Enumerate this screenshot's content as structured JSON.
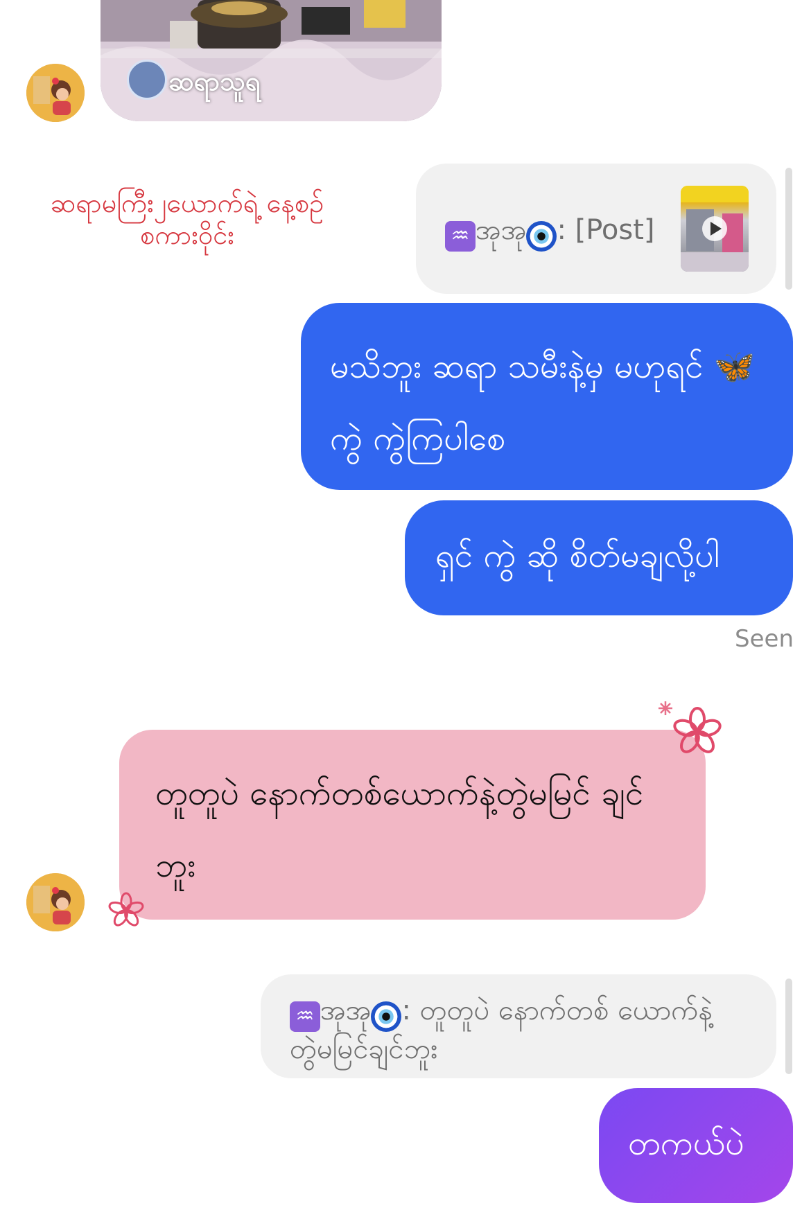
{
  "reel": {
    "author": "ဆရာသူရ"
  },
  "note": {
    "text": "ဆရာမကြီး၂ယောက်ရဲ့ နေ့စဥ်စကားဝိုင်း"
  },
  "reply_post": {
    "sender": "အုအု",
    "text": ": [Post]"
  },
  "messages": {
    "out_1": "မသိဘူး ဆရာ သမီးနဲ့မှ မဟုရင် 🦋ကွဲ ကွဲကြပါစေ",
    "out_2": "ရှင် ကွဲ ဆို စိတ်မချလို့ပါ",
    "status": "Seen",
    "in_1": "တူတူပဲ နောက်တစ်ယောက်နဲ့တွဲမမြင် ချင်ဘူး",
    "reply_text_sender": "အုအု",
    "reply_text": ": တူတူပဲ နောက်တစ် ယောက်နဲ့တွဲမမြင်ချင်ဘူး",
    "out_3": "တကယ်ပဲ"
  },
  "icons": {
    "aquarius": "♒",
    "play": "play-icon",
    "evil_eye": "nazar-icon"
  }
}
